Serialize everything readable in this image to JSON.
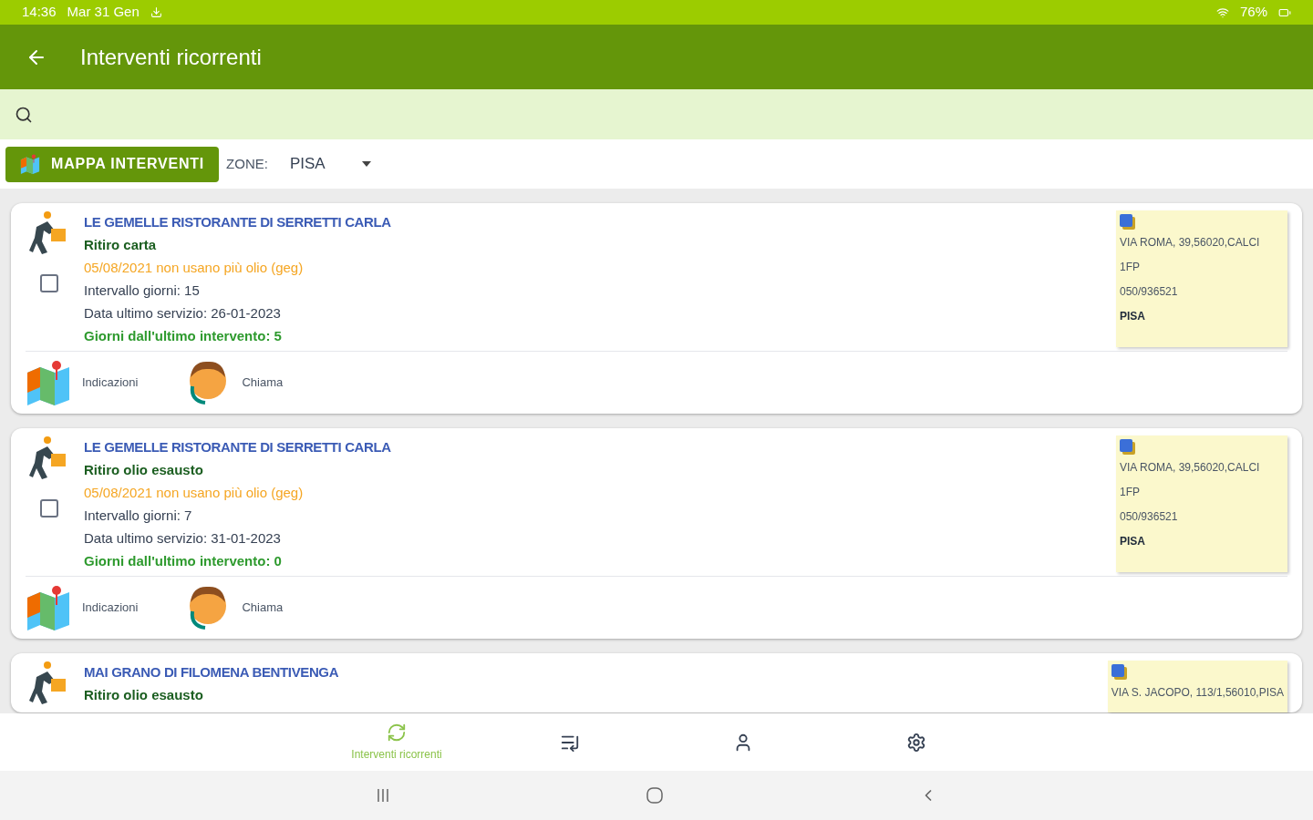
{
  "status_bar": {
    "time": "14:36",
    "date": "Mar 31 Gen",
    "battery": "76%"
  },
  "app_bar": {
    "title": "Interventi ricorrenti"
  },
  "toolbar": {
    "map_button": "MAPPA INTERVENTI",
    "zone_label": "ZONE:",
    "zone_value": "PISA"
  },
  "cards": [
    {
      "title": "LE GEMELLE RISTORANTE DI SERRETTI CARLA",
      "service": "Ritiro carta",
      "note": "05/08/2021 non usano più olio (geg)",
      "checked": false,
      "interval": "Intervallo giorni: 15",
      "last_service": "Data ultimo servizio: 26-01-2023",
      "days_since": "Giorni dall'ultimo intervento: 5",
      "info": [
        "VIA ROMA, 39,56020,CALCI",
        "1FP",
        "050/936521",
        "PISA"
      ],
      "actions": [
        "Indicazioni",
        "Chiama"
      ]
    },
    {
      "title": "LE GEMELLE RISTORANTE DI SERRETTI CARLA",
      "service": "Ritiro olio esausto",
      "note": "05/08/2021 non usano più olio (geg)",
      "checked": false,
      "interval": "Intervallo giorni: 7",
      "last_service": "Data ultimo servizio: 31-01-2023",
      "days_since": "Giorni dall'ultimo intervento: 0",
      "info": [
        "VIA ROMA, 39,56020,CALCI",
        "1FP",
        "050/936521",
        "PISA"
      ],
      "actions": [
        "Indicazioni",
        "Chiama"
      ]
    },
    {
      "title": "MAI GRANO DI FILOMENA BENTIVENGA",
      "service": "Ritiro olio esausto",
      "info": [
        "VIA S. JACOPO, 113/1,56010,PISA"
      ]
    }
  ],
  "bottom_nav": [
    {
      "kind": "recurring",
      "label": "Interventi ricorrenti",
      "selected": true
    },
    {
      "kind": "list",
      "selected": false
    },
    {
      "kind": "person",
      "selected": false
    },
    {
      "kind": "settings",
      "selected": false
    }
  ]
}
